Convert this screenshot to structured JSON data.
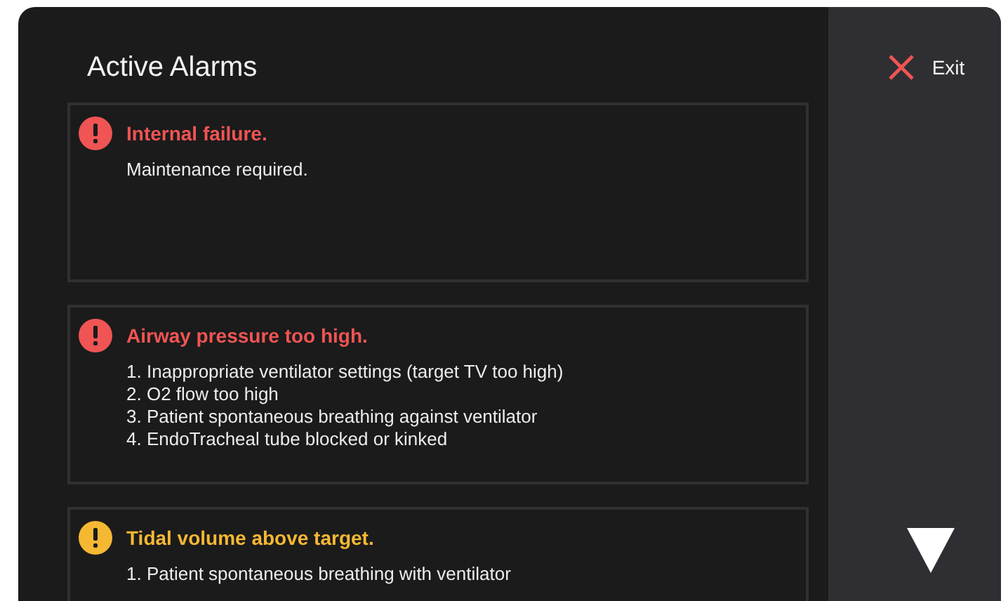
{
  "title": "Active Alarms",
  "alarms": [
    {
      "color": "#f05454",
      "title": "Internal failure.",
      "lines": [
        "Maintenance required."
      ]
    },
    {
      "color": "#f05454",
      "title": "Airway pressure too high.",
      "lines": [
        "1. Inappropriate ventilator settings (target TV too high)",
        "2. O2 flow too high",
        "3. Patient spontaneous breathing against ventilator",
        "4. EndoTracheal tube blocked or kinked"
      ]
    },
    {
      "color": "#f5b833",
      "title": "Tidal volume above target.",
      "lines": [
        "1. Patient spontaneous breathing with ventilator"
      ]
    }
  ],
  "exit_button": {
    "label": "Exit"
  }
}
